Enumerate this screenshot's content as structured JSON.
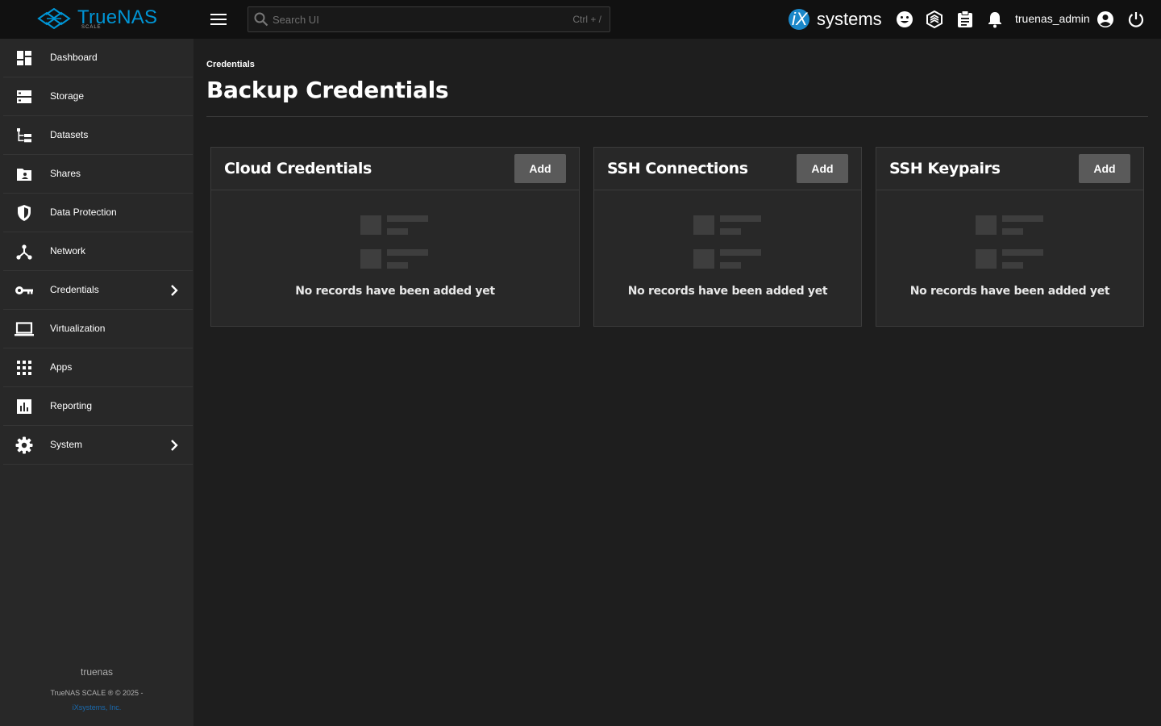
{
  "brand": {
    "name": "TrueNAS",
    "edition": "SCALE",
    "accent_color": "#0095d5"
  },
  "topbar": {
    "menu_icon": "hamburger-menu-icon",
    "search": {
      "placeholder": "Search UI",
      "shortcut": "Ctrl + /",
      "icon": "search-icon"
    },
    "vendor_logo": {
      "prefix": "iX",
      "text": "systems"
    },
    "icons": [
      "feedback-icon",
      "truecommand-icon",
      "jobs-clipboard-icon",
      "notifications-bell-icon"
    ],
    "username": "truenas_admin",
    "account_icon": "account-circle-icon",
    "power_icon": "power-icon"
  },
  "sidebar": {
    "items": [
      {
        "label": "Dashboard",
        "icon": "dashboard-icon",
        "has_children": false
      },
      {
        "label": "Storage",
        "icon": "storage-icon",
        "has_children": false
      },
      {
        "label": "Datasets",
        "icon": "datasets-tree-icon",
        "has_children": false
      },
      {
        "label": "Shares",
        "icon": "shares-folder-icon",
        "has_children": false
      },
      {
        "label": "Data Protection",
        "icon": "shield-icon",
        "has_children": false
      },
      {
        "label": "Network",
        "icon": "network-hub-icon",
        "has_children": false
      },
      {
        "label": "Credentials",
        "icon": "key-icon",
        "has_children": true
      },
      {
        "label": "Virtualization",
        "icon": "laptop-icon",
        "has_children": false
      },
      {
        "label": "Apps",
        "icon": "apps-grid-icon",
        "has_children": false
      },
      {
        "label": "Reporting",
        "icon": "reporting-chart-icon",
        "has_children": false
      },
      {
        "label": "System",
        "icon": "gear-icon",
        "has_children": true
      }
    ],
    "hostname": "truenas",
    "copyright": "TrueNAS SCALE ® © 2025 -",
    "company": "iXsystems, Inc."
  },
  "main": {
    "breadcrumb": "Credentials",
    "title": "Backup Credentials",
    "cards": [
      {
        "title": "Cloud Credentials",
        "add_label": "Add",
        "empty_text": "No records have been added yet"
      },
      {
        "title": "SSH Connections",
        "add_label": "Add",
        "empty_text": "No records have been added yet"
      },
      {
        "title": "SSH Keypairs",
        "add_label": "Add",
        "empty_text": "No records have been added yet"
      }
    ]
  }
}
